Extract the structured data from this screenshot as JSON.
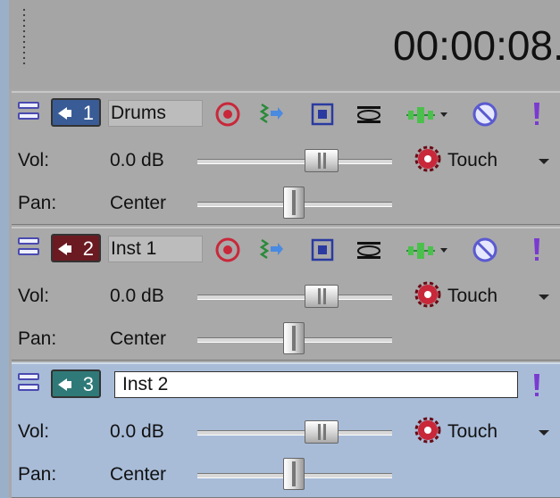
{
  "time_display": "00:00:08.",
  "tracks": [
    {
      "number": "1",
      "name": "Drums",
      "color": "#3a5c96",
      "volume_label": "Vol:",
      "volume_value": "0.0 dB",
      "pan_label": "Pan:",
      "pan_value": "Center",
      "automation_mode": "Touch"
    },
    {
      "number": "2",
      "name": "Inst 1",
      "color": "#6b1a22",
      "volume_label": "Vol:",
      "volume_value": "0.0 dB",
      "pan_label": "Pan:",
      "pan_value": "Center",
      "automation_mode": "Touch"
    },
    {
      "number": "3",
      "name": "Inst 2",
      "color": "#2f7a78",
      "volume_label": "Vol:",
      "volume_value": "0.0 dB",
      "pan_label": "Pan:",
      "pan_value": "Center",
      "automation_mode": "Touch"
    }
  ],
  "icons": {
    "arm": "record-arm-icon",
    "fx": "track-fx-icon",
    "motion": "track-motion-icon",
    "compositing": "compositing-icon",
    "envelope": "envelope-icon",
    "mute": "mute-icon",
    "solo": "solo-icon",
    "automation": "automation-gear-icon"
  }
}
